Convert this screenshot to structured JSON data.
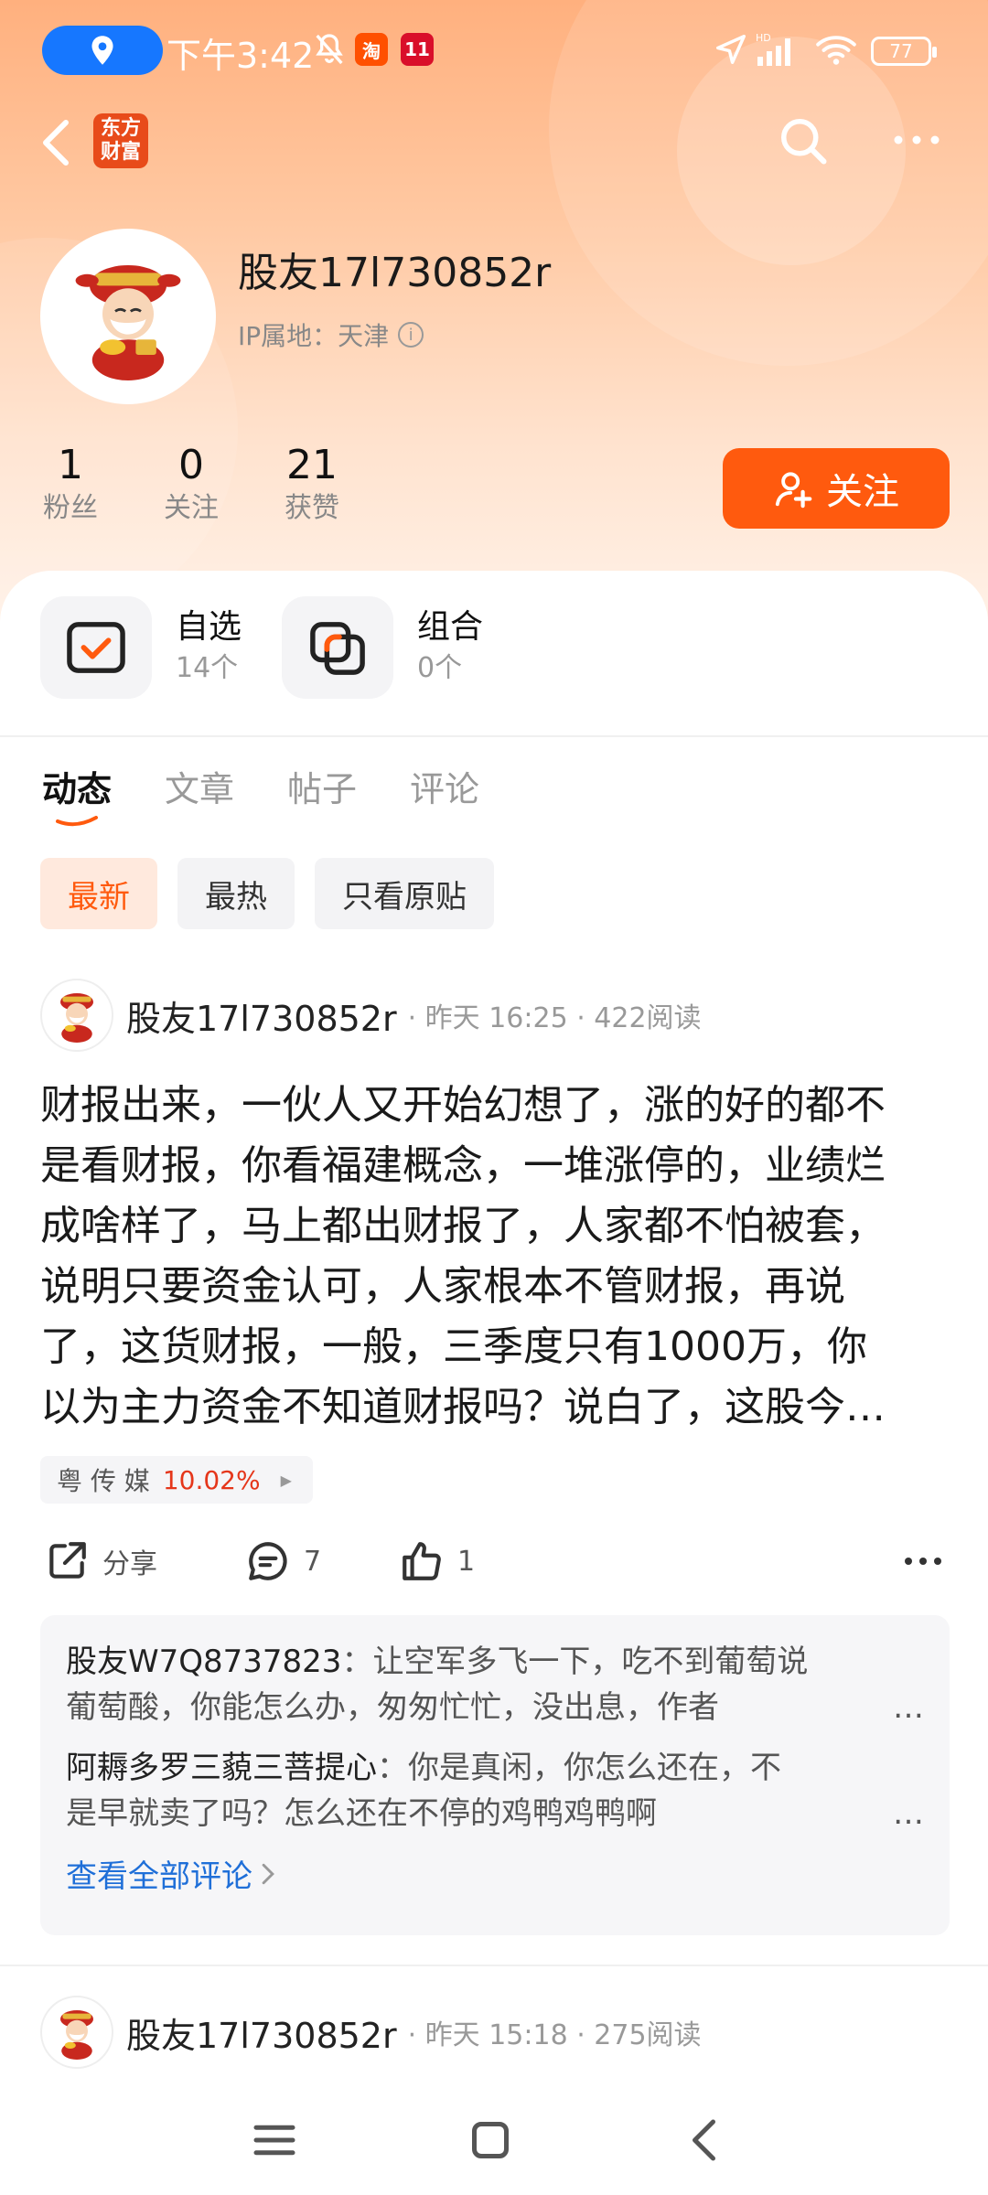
{
  "status_bar": {
    "time": "下午3:42",
    "battery": "77",
    "network_label": "HD",
    "app_icons": [
      "taobao-app-icon",
      "tmall-app-icon"
    ]
  },
  "nav": {
    "app_logo_text": "东方财富"
  },
  "profile": {
    "username": "股友17l730852r",
    "ip_label": "IP属地：",
    "ip_value": "天津",
    "stats": [
      {
        "value": "1",
        "label": "粉丝"
      },
      {
        "value": "0",
        "label": "关注"
      },
      {
        "value": "21",
        "label": "获赞"
      }
    ],
    "follow_label": "关注"
  },
  "shortcuts": [
    {
      "title": "自选",
      "sub": "14个",
      "icon": "watchlist-icon"
    },
    {
      "title": "组合",
      "sub": "0个",
      "icon": "portfolio-icon"
    }
  ],
  "tabs": [
    {
      "label": "动态",
      "active": true
    },
    {
      "label": "文章",
      "active": false
    },
    {
      "label": "帖子",
      "active": false
    },
    {
      "label": "评论",
      "active": false
    }
  ],
  "filters": [
    {
      "label": "最新",
      "active": true
    },
    {
      "label": "最热",
      "active": false
    },
    {
      "label": "只看原贴",
      "active": false
    }
  ],
  "posts": [
    {
      "author": "股友17l730852r",
      "time": "昨天 16:25",
      "reads": "422阅读",
      "body_lines": [
        "财报出来，一伙人又开始幻想了，涨的好的都不",
        "是看财报，你看福建概念，一堆涨停的，业绩烂",
        "成啥样了，马上都出财报了，人家都不怕被套，",
        "说明只要资金认可，人家根本不管财报，再说",
        "了，这货财报，一般，三季度只有1000万，你",
        "以为主力资金不知道财报吗？说白了，这股今…"
      ],
      "stock": {
        "name": "粤 传 媒",
        "change": "10.02%"
      },
      "actions": {
        "share": "分享",
        "comments": "7",
        "likes": "1"
      },
      "comments": [
        {
          "author": "股友W7Q8737823",
          "sep": "：",
          "text_l1": "让空军多飞一下，吃不到葡萄说",
          "text_l2": "葡萄酸，你能怎么办，匆匆忙忙，没出息，作者"
        },
        {
          "author": "阿耨多罗三藐三菩提心",
          "sep": "：",
          "text_l1": "你是真闲，你怎么还在，不",
          "text_l2": "是早就卖了吗？怎么还在不停的鸡鸭鸡鸭啊"
        }
      ],
      "view_all": "查看全部评论"
    },
    {
      "author": "股友17l730852r",
      "time": "昨天 15:18",
      "reads": "275阅读"
    }
  ],
  "colors": {
    "accent": "#ff5a0e",
    "link": "#1f6fd8",
    "stock_up": "#e5361a"
  }
}
